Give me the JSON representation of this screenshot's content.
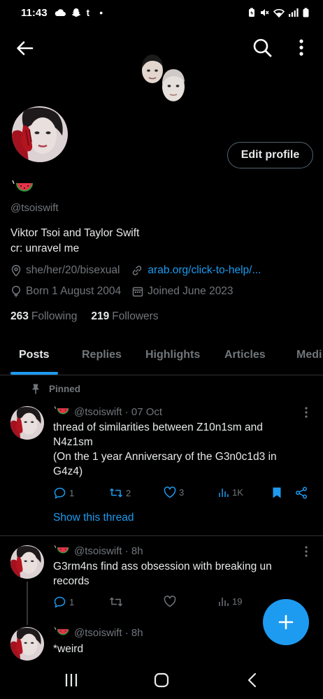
{
  "status_bar": {
    "time": "11:43",
    "left_icons": [
      "cloud-icon",
      "snapchat-icon",
      "tumblr-icon",
      "dot-icon"
    ],
    "right_icons": [
      "battery-saver-icon",
      "mute-icon",
      "wifi-icon",
      "signal-icon",
      "battery-icon"
    ],
    "tumblr_glyph": "t",
    "dot_glyph": "•"
  },
  "topbar": {
    "back_icon": "arrow-left-icon",
    "search_icon": "search-icon",
    "more_icon": "more-vertical-icon"
  },
  "profile": {
    "edit_profile_label": "Edit profile",
    "display_name_emoji": "watermelon",
    "handle": "@tsoiswift",
    "bio_line1": "Viktor Tsoi and Taylor Swift",
    "bio_line2": "cr: unravel me",
    "pronouns": "she/her/20/bisexual",
    "link": "arab.org/click-to-help/...",
    "born": "Born 1 August 2004",
    "joined": "Joined June 2023",
    "following_count": "263",
    "following_label": "Following",
    "followers_count": "219",
    "followers_label": "Followers"
  },
  "tabs": [
    {
      "label": "Posts",
      "active": true
    },
    {
      "label": "Replies",
      "active": false
    },
    {
      "label": "Highlights",
      "active": false
    },
    {
      "label": "Articles",
      "active": false
    },
    {
      "label": "Medi",
      "active": false
    }
  ],
  "pinned_label": "Pinned",
  "posts": [
    {
      "header": "@tsoiswift · 07 Oct",
      "lines": [
        "thread of similarities between  Z10n1sm  and",
        "N4z1sm",
        "(On the 1 year Anniversary of the G3n0c1d3 in",
        "G4z4)"
      ],
      "replies": "1",
      "reposts": "2",
      "likes": "3",
      "views": "1K",
      "bookmarked": true,
      "show_thread": "Show this thread"
    },
    {
      "header": "@tsoiswift · 8h",
      "lines": [
        "G3rm4ns find ass  obsession with breaking  un",
        "records"
      ],
      "replies": "1",
      "reposts": "",
      "likes": "",
      "views": "19"
    },
    {
      "header": "@tsoiswift · 8h",
      "lines": [
        "*weird"
      ]
    }
  ],
  "fab_icon": "plus-icon",
  "navbar": {
    "recents_icon": "recents-icon",
    "home_icon": "home-icon",
    "back_icon": "back-chevron-icon"
  },
  "colors": {
    "background": "#000000",
    "accent": "#1d9bf0",
    "text_primary": "#e7e9ea",
    "text_secondary": "#71767b",
    "divider": "#2f3336"
  }
}
